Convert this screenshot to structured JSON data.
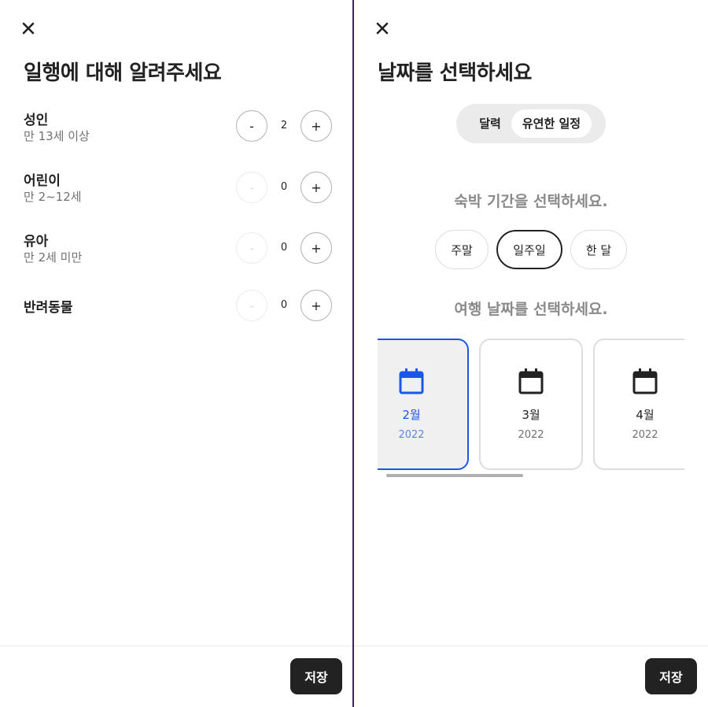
{
  "guests_panel": {
    "title": "일행에 대해 알려주세요",
    "rows": [
      {
        "label": "성인",
        "sub": "만 13세 이상",
        "count": "2",
        "minus": "-",
        "plus": "+"
      },
      {
        "label": "어린이",
        "sub": "만 2~12세",
        "count": "0",
        "minus": "-",
        "plus": "+"
      },
      {
        "label": "유아",
        "sub": "만 2세 미만",
        "count": "0",
        "minus": "-",
        "plus": "+"
      },
      {
        "label": "반려동물",
        "sub": "",
        "count": "0",
        "minus": "-",
        "plus": "+"
      }
    ],
    "save_label": "저장"
  },
  "dates_panel": {
    "title": "날짜를 선택하세요",
    "tabs": {
      "calendar": "달력",
      "flexible": "유연한 일정"
    },
    "stay_heading": "숙박 기간을 선택하세요.",
    "stay_options": [
      "주말",
      "일주일",
      "한 달"
    ],
    "selected_stay": "일주일",
    "trip_heading": "여행 날짜를 선택하세요.",
    "months": [
      {
        "name": "2월",
        "year": "2022",
        "selected": true
      },
      {
        "name": "3월",
        "year": "2022",
        "selected": false
      },
      {
        "name": "4월",
        "year": "2022",
        "selected": false
      }
    ],
    "save_label": "저장"
  },
  "icons": {
    "close": "close-icon",
    "calendar": "calendar-icon"
  },
  "colors": {
    "accent": "#1a56e8",
    "button_dark": "#222222",
    "muted_text": "#717171",
    "divider": "#3b1f73"
  }
}
